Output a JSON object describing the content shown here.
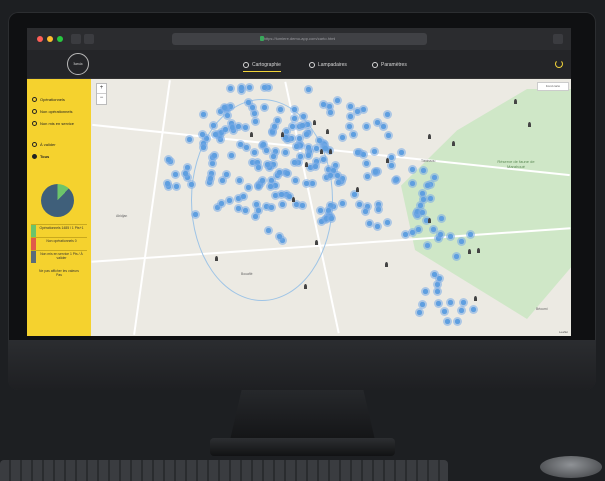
{
  "browser": {
    "url": "https://lumiere.demo-app.com/carto.html"
  },
  "app": {
    "logo_text": "lumia",
    "nav": [
      {
        "label": "Cartographie",
        "icon": "pin-icon",
        "active": true
      },
      {
        "label": "Lampadaires",
        "icon": "clock-icon",
        "active": false
      },
      {
        "label": "Paramètres",
        "icon": "gear-icon",
        "active": false
      }
    ],
    "accent_color": "#f5d22e"
  },
  "sidebar": {
    "items": [
      {
        "label": "Opérationnels",
        "icon": "circle-icon"
      },
      {
        "label": "Non opérationnels",
        "icon": "circle-icon"
      },
      {
        "label": "Non mis en service",
        "icon": "circle-icon"
      },
      {
        "label": "À valider",
        "icon": "circle-icon"
      },
      {
        "label": "Tous",
        "icon": "all-icon"
      }
    ],
    "pie": {
      "operational_pct": 88,
      "colors": [
        "#3f5f7a",
        "#6cc46a"
      ]
    },
    "legend": [
      {
        "label": "Opérationnels 1485 / 1 Pts+1",
        "color": "#6cc46a"
      },
      {
        "label": "Non opérationnels 0",
        "color": "#e05a4a"
      },
      {
        "label": "Non mis en service 1 Pts / À valider",
        "color": "#5b6b7a"
      }
    ],
    "footer": "Ne pas afficher les valeurs",
    "footer_sub": "Pas"
  },
  "map": {
    "zoom_in": "+",
    "zoom_out": "−",
    "top_right_label": "Fond carto",
    "attribution": "Leaflet",
    "labels": [
      {
        "text": "Abidjan"
      },
      {
        "text": "Bouaflé"
      },
      {
        "text": "Tiébissou"
      },
      {
        "text": "Béoumi"
      }
    ],
    "park_label": "Réserve de faune de Marahoué"
  }
}
